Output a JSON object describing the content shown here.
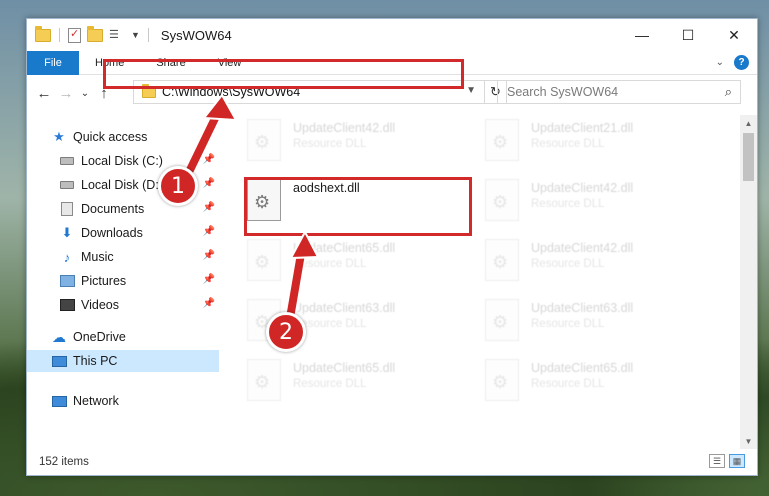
{
  "window": {
    "title": "SysWOW64"
  },
  "titlebar": {
    "minimize_glyph": "—",
    "maximize_glyph": "☐",
    "close_glyph": "✕"
  },
  "ribbon": {
    "tabs": [
      "File",
      "Home",
      "Share",
      "View"
    ],
    "help_glyph": "?"
  },
  "nav": {
    "back_glyph": "←",
    "forward_glyph": "→",
    "recent_glyph": "⌄",
    "up_glyph": "↑",
    "address": "C:\\Windows\\SysWOW64",
    "refresh_glyph": "↻",
    "search_placeholder": "Search SysWOW64"
  },
  "sidebar": {
    "items": [
      {
        "label": "Quick access",
        "icon": "star-icon"
      },
      {
        "label": "Local Disk (C:)",
        "icon": "disk-icon",
        "pinned": true
      },
      {
        "label": "Local Disk (D:)",
        "icon": "disk-icon",
        "pinned": true
      },
      {
        "label": "Documents",
        "icon": "documents-icon",
        "pinned": true
      },
      {
        "label": "Downloads",
        "icon": "downloads-icon",
        "pinned": true
      },
      {
        "label": "Music",
        "icon": "music-icon",
        "pinned": true
      },
      {
        "label": "Pictures",
        "icon": "pictures-icon",
        "pinned": true
      },
      {
        "label": "Videos",
        "icon": "videos-icon",
        "pinned": true
      },
      {
        "label": "OneDrive",
        "icon": "cloud-icon"
      },
      {
        "label": "This PC",
        "icon": "pc-icon",
        "selected": true
      },
      {
        "label": "Network",
        "icon": "network-icon"
      }
    ]
  },
  "files": {
    "highlighted": {
      "name": "aodshext.dll"
    },
    "background_items": [
      {
        "name": "UpdateClient42.dll",
        "type": "Resource DLL"
      },
      {
        "name": "UpdateClient21.dll",
        "type": "Resource DLL"
      },
      {
        "name": "UpdateClient42.dll",
        "type": "Resource DLL"
      },
      {
        "name": "UpdateClient65.dll",
        "type": "Resource DLL"
      },
      {
        "name": "UpdateClient42.dll",
        "type": "Resource DLL"
      },
      {
        "name": "UpdateClient63.dll",
        "type": "Resource DLL"
      },
      {
        "name": "UpdateClient63.dll",
        "type": "Resource DLL"
      },
      {
        "name": "UpdateClient65.dll",
        "type": "Resource DLL"
      },
      {
        "name": "UpdateClient65.dll",
        "type": "Resource DLL"
      }
    ]
  },
  "status": {
    "item_count": "152 items"
  },
  "annotations": {
    "step1": "1",
    "step2": "2",
    "highlight_color": "#d22a2a"
  }
}
